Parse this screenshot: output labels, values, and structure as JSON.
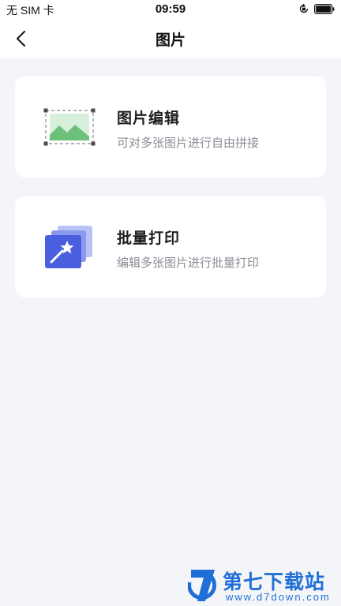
{
  "status_bar": {
    "carrier": "无 SIM 卡",
    "time": "09:59",
    "icons": [
      "rotation-lock-icon",
      "battery-icon"
    ]
  },
  "nav": {
    "back_icon": "chevron-left-icon",
    "title": "图片"
  },
  "cards": [
    {
      "icon": "image-edit-icon",
      "title": "图片编辑",
      "description": "可对多张图片进行自由拼接"
    },
    {
      "icon": "batch-print-icon",
      "title": "批量打印",
      "description": "编辑多张图片进行批量打印"
    }
  ],
  "watermark": {
    "name": "第七下载站",
    "url": "www.d7down.com"
  },
  "colors": {
    "background": "#f4f5f9",
    "card": "#ffffff",
    "image_icon_green": "#6cc07a",
    "print_icon_blue": "#4a5fe0",
    "watermark_blue": "#1f6fd6"
  }
}
